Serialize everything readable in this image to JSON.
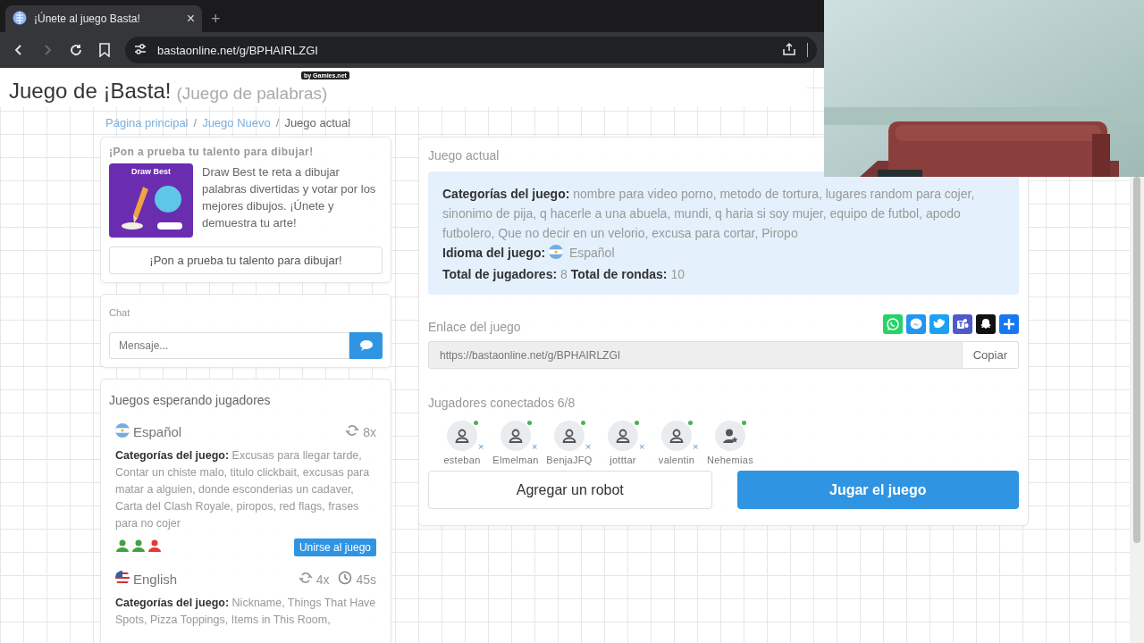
{
  "browser": {
    "tab_title": "¡Únete al juego Basta!",
    "close": "×",
    "new_tab": "+",
    "nav": [
      {
        "kind": "back",
        "disabled": false
      },
      {
        "kind": "forward",
        "disabled": true
      },
      {
        "kind": "reload",
        "disabled": false
      }
    ],
    "url": "bastaonline.net/g/BPHAIRLZGI"
  },
  "header": {
    "badge": "by Gamies.net",
    "title": "Juego de ¡Basta!",
    "subtitle": "(Juego de palabras)"
  },
  "breadcrumb": [
    {
      "label": "Página principal",
      "kind": "link"
    },
    {
      "label": "/",
      "kind": "separator"
    },
    {
      "label": "Juego Nuevo",
      "kind": "link"
    },
    {
      "label": "/",
      "kind": "separator"
    },
    {
      "label": "Juego actual",
      "kind": "current"
    }
  ],
  "promo": {
    "heading": "¡Pon a prueba tu talento para dibujar!",
    "image_title": "Draw Best",
    "text": "Draw Best te reta a dibujar palabras divertidas y votar por los mejores dibujos. ¡Únete y demuestra tu arte!",
    "button": "¡Pon a prueba tu talento para dibujar!"
  },
  "chat": {
    "title": "Chat",
    "placeholder": "Mensaje..."
  },
  "waiting": {
    "title": "Juegos esperando jugadores",
    "games": [
      {
        "kind": "argentina",
        "language": "Español",
        "rounds": "8x",
        "categories": "**Categorías del juego:** Excusas para llegar tarde, Contar un chiste malo, titulo clickbait, excusas para matar a alguien, donde esconderias un cadaver, Carta del Clash Royale, piropos, red flags, frases para no cojer",
        "slots": [
          {
            "filled": true
          },
          {
            "filled": true
          },
          {
            "filled": false
          }
        ],
        "join": "Unirse al juego"
      },
      {
        "kind": "usa",
        "language": "English",
        "rounds": "4x",
        "time": "45s",
        "categories": "**Categorías del juego:** Nickname, Things That Have Spots, Pizza Toppings, Items in This Room,"
      }
    ]
  },
  "current": {
    "title": "Juego actual",
    "info": [
      {
        "text": "**Categorías del juego:** nombre para video porno, metodo de tortura, lugares random para cojer, sinonimo de pija, q hacerle a una abuela, mundi, q haria si soy mujer, equipo de futbol, apodo futbolero, Que no decir en un velorio, excusa para cortar, Piropo"
      },
      {
        "text": "**Idioma del juego:** Español",
        "kind": "argentina"
      },
      {
        "text": "**Total de jugadores:** 8 **Total de rondas:** 10"
      }
    ],
    "link_label": "Enlace del juego",
    "share": [
      {
        "kind": "whatsapp"
      },
      {
        "kind": "messenger"
      },
      {
        "kind": "twitter"
      },
      {
        "kind": "teams"
      },
      {
        "kind": "snapchat"
      },
      {
        "kind": "more"
      }
    ],
    "link": "https://bastaonline.net/g/BPHAIRLZGI",
    "copy": "Copiar",
    "players_title": "Jugadores conectados 6/8",
    "players": [
      {
        "name": "esteban",
        "kind": "player",
        "online": true,
        "removable": true
      },
      {
        "name": "Elmelman",
        "kind": "player",
        "online": true,
        "removable": true
      },
      {
        "name": "BenjaJFQ",
        "kind": "player",
        "online": true,
        "removable": true
      },
      {
        "name": "jotttar",
        "kind": "player",
        "online": true,
        "removable": true
      },
      {
        "name": "valentin",
        "kind": "player",
        "online": true,
        "removable": true
      },
      {
        "name": "Nehemias",
        "kind": "host",
        "online": true,
        "removable": false
      }
    ],
    "remove": "×",
    "actions": [
      {
        "label": "Agregar un robot",
        "kind": "secondary"
      },
      {
        "label": "Jugar el juego",
        "kind": "primary"
      }
    ]
  }
}
